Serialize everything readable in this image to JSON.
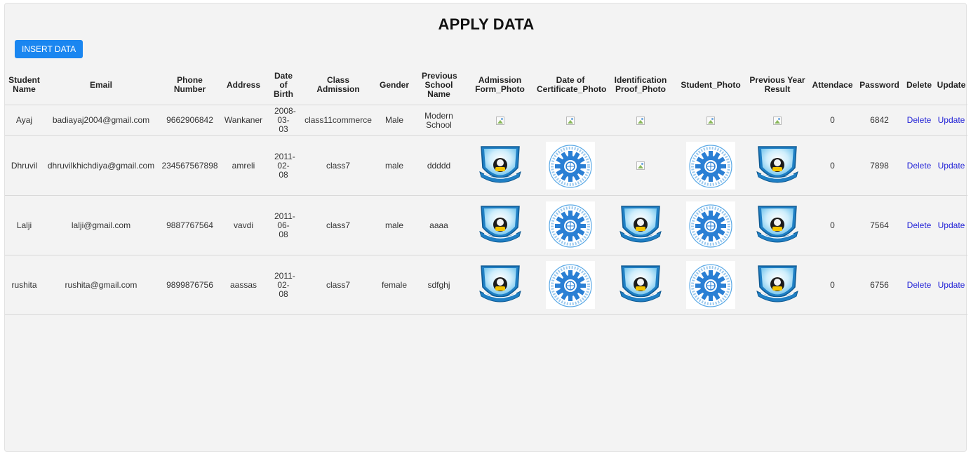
{
  "page": {
    "title": "APPLY DATA"
  },
  "toolbar": {
    "insert_label": "INSERT DATA"
  },
  "table": {
    "headers": [
      "Student Name",
      "Email",
      "Phone Number",
      "Address",
      "Date of Birth",
      "Class Admission",
      "Gender",
      "Previous School Name",
      "Admission Form_Photo",
      "Date of Certificate_Photo",
      "Identification Proof_Photo",
      "Student_Photo",
      "Previous Year Result",
      "Attendace",
      "Password",
      "Delete",
      "Update"
    ],
    "rows": [
      {
        "name": "Ayaj",
        "email": "badiayaj2004@gmail.com",
        "phone": "9662906842",
        "address": "Wankaner",
        "dob": "2008-03-03",
        "class": "class11commerce",
        "gender": "Male",
        "prev_school": "Modern School",
        "photos": [
          "broken",
          "broken",
          "broken",
          "broken",
          "broken"
        ],
        "attendance": "0",
        "password": "6842",
        "delete": "Delete",
        "update": "Update"
      },
      {
        "name": "Dhruvil",
        "email": "dhruvilkhichdiya@gmail.com",
        "phone": "234567567898",
        "address": "amreli",
        "dob": "2011-02-08",
        "class": "class7",
        "gender": "male",
        "prev_school": "ddddd",
        "photos": [
          "ksv-logo",
          "gear-logo",
          "broken",
          "gear-logo",
          "ksv-logo"
        ],
        "attendance": "0",
        "password": "7898",
        "delete": "Delete",
        "update": "Update"
      },
      {
        "name": "Lalji",
        "email": "lalji@gmail.com",
        "phone": "9887767564",
        "address": "vavdi",
        "dob": "2011-06-08",
        "class": "class7",
        "gender": "male",
        "prev_school": "aaaa",
        "photos": [
          "ksv-logo",
          "gear-logo",
          "ksv-logo",
          "gear-logo",
          "ksv-logo"
        ],
        "attendance": "0",
        "password": "7564",
        "delete": "Delete",
        "update": "Update"
      },
      {
        "name": "rushita",
        "email": "rushita@gmail.com",
        "phone": "9899876756",
        "address": "aassas",
        "dob": "2011-02-08",
        "class": "class7",
        "gender": "female",
        "prev_school": "sdfghj",
        "photos": [
          "ksv-logo",
          "gear-logo",
          "ksv-logo",
          "gear-logo",
          "ksv-logo"
        ],
        "attendance": "0",
        "password": "6756",
        "delete": "Delete",
        "update": "Update"
      }
    ]
  },
  "colors": {
    "button": "#1a86f0",
    "link": "#1f1fd6",
    "background": "#f3f3f3"
  }
}
